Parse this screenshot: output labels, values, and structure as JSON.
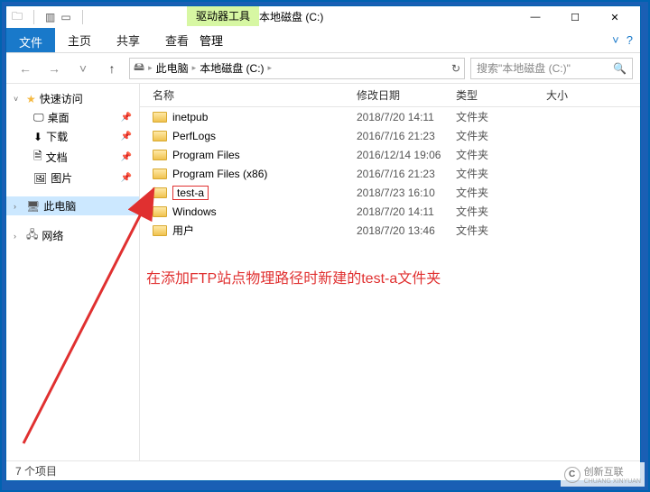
{
  "title": {
    "context_tab": "驱动器工具",
    "window_title": "本地磁盘 (C:)"
  },
  "winbtns": {
    "min": "—",
    "max": "☐",
    "close": "✕"
  },
  "ribbon": {
    "file": "文件",
    "home": "主页",
    "share": "共享",
    "view": "查看",
    "manage": "管理",
    "expand": "˅",
    "help": "?"
  },
  "addr": {
    "breadcrumb": {
      "this_pc": "此电脑",
      "drive": "本地磁盘 (C:)"
    },
    "search_placeholder": "搜索\"本地磁盘 (C:)\""
  },
  "sidebar": {
    "quick": "快速访问",
    "items": [
      {
        "label": "桌面"
      },
      {
        "label": "下载"
      },
      {
        "label": "文档"
      },
      {
        "label": "图片"
      }
    ],
    "this_pc": "此电脑",
    "network": "网络"
  },
  "columns": {
    "name": "名称",
    "date": "修改日期",
    "type": "类型",
    "size": "大小"
  },
  "files": [
    {
      "name": "inetpub",
      "date": "2018/7/20 14:11",
      "type": "文件夹",
      "highlight": false
    },
    {
      "name": "PerfLogs",
      "date": "2016/7/16 21:23",
      "type": "文件夹",
      "highlight": false
    },
    {
      "name": "Program Files",
      "date": "2016/12/14 19:06",
      "type": "文件夹",
      "highlight": false
    },
    {
      "name": "Program Files (x86)",
      "date": "2016/7/16 21:23",
      "type": "文件夹",
      "highlight": false
    },
    {
      "name": "test-a",
      "date": "2018/7/23 16:10",
      "type": "文件夹",
      "highlight": true
    },
    {
      "name": "Windows",
      "date": "2018/7/20 14:11",
      "type": "文件夹",
      "highlight": false
    },
    {
      "name": "用户",
      "date": "2018/7/20 13:46",
      "type": "文件夹",
      "highlight": false
    }
  ],
  "status": {
    "count": "7 个项目"
  },
  "annotation": "在添加FTP站点物理路径时新建的test-a文件夹",
  "watermark": {
    "brand": "创新互联",
    "sub": "CHUANG XINYUAN"
  }
}
